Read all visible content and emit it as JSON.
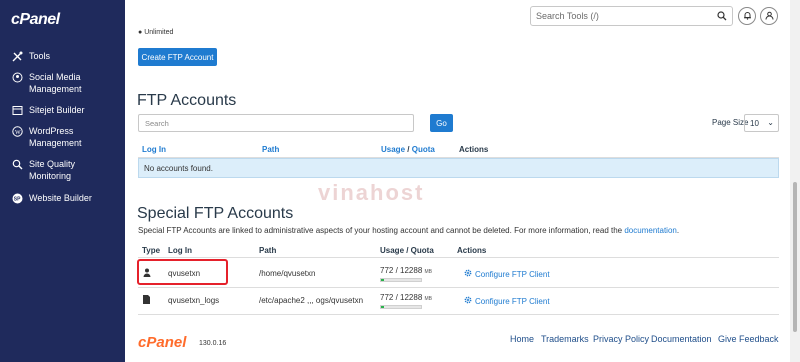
{
  "brand": {
    "logo_text": "cPanel"
  },
  "sidebar": {
    "items": [
      {
        "label": "Tools",
        "icon": "tools-icon"
      },
      {
        "label": "Social Media Management",
        "icon": "social-media-icon"
      },
      {
        "label": "Sitejet Builder",
        "icon": "sitejet-icon"
      },
      {
        "label": "WordPress Management",
        "icon": "wordpress-icon"
      },
      {
        "label": "Site Quality Monitoring",
        "icon": "site-quality-icon"
      },
      {
        "label": "Website Builder",
        "icon": "website-builder-icon"
      }
    ]
  },
  "header": {
    "search_placeholder": "Search Tools (/)"
  },
  "top": {
    "unlimited_label": "Unlimited",
    "create_button": "Create FTP Account"
  },
  "ftp_accounts": {
    "title": "FTP Accounts",
    "search_placeholder": "Search",
    "go_button": "Go",
    "page_size_label": "Page Size",
    "page_size_value": "10",
    "columns": {
      "login": "Log In",
      "path": "Path",
      "usage": "Usage",
      "slash": "/",
      "quota": "Quota",
      "actions": "Actions"
    },
    "empty_message": "No accounts found."
  },
  "special": {
    "title": "Special FTP Accounts",
    "description": "Special FTP Accounts are linked to administrative aspects of your hosting account and cannot be deleted. For more information, read the",
    "doc_link": "documentation",
    "period": ".",
    "columns": {
      "type": "Type",
      "login": "Log In",
      "path": "Path",
      "usage_quota": "Usage / Quota",
      "actions": "Actions"
    },
    "rows": [
      {
        "type_icon": "user-icon",
        "login": "qvusetxn",
        "path": "/home/qvusetxn",
        "usage": "772 / 12288",
        "unit": "MB",
        "usage_fraction": 0.063,
        "action": "Configure FTP Client"
      },
      {
        "type_icon": "file-icon",
        "login": "qvusetxn_logs",
        "path": "/etc/apache2 ,,, ogs/qvusetxn",
        "usage": "772 / 12288",
        "unit": "MB",
        "usage_fraction": 0.063,
        "action": "Configure FTP Client"
      }
    ]
  },
  "watermark": "vinahost",
  "footer": {
    "logo": "cPanel",
    "version": "130.0.16",
    "links": [
      "Home",
      "Trademarks",
      "Privacy Policy",
      "Documentation",
      "Give Feedback"
    ]
  },
  "colors": {
    "sidebar": "#1f2a5c",
    "primary": "#1f7bd0",
    "highlight": "#e5212b",
    "usage_fill": "#2bb24c"
  }
}
